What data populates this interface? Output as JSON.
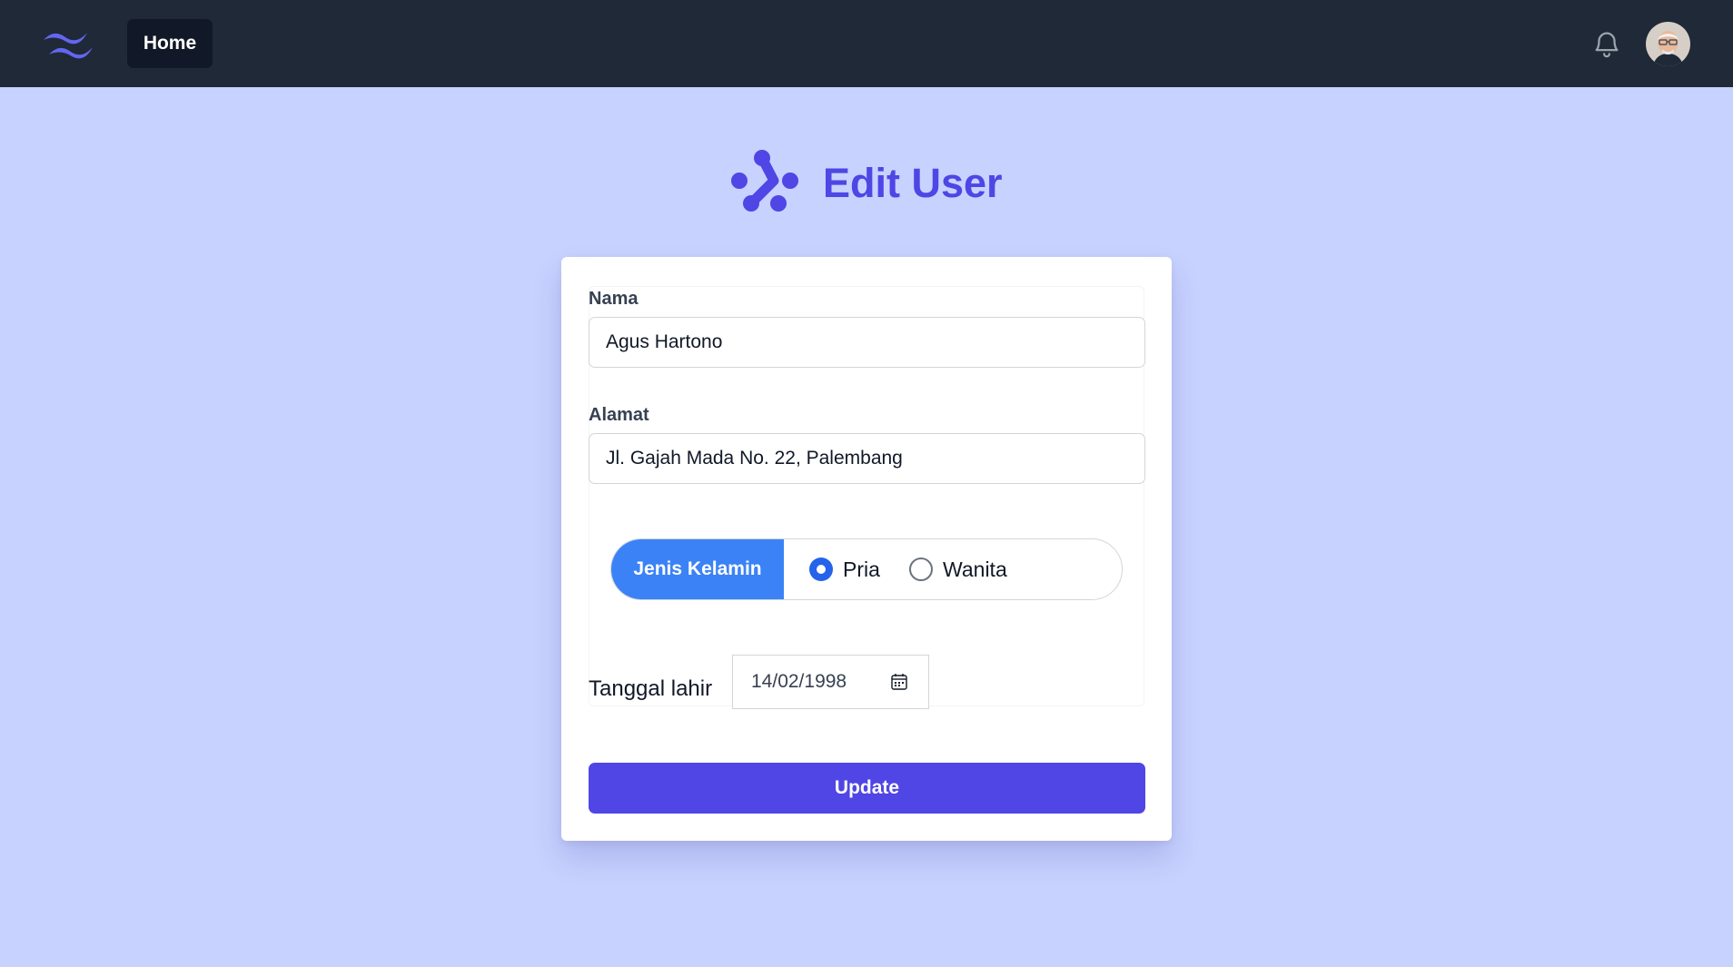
{
  "navbar": {
    "logo_icon": "tailwind-waves-icon",
    "home_label": "Home",
    "bell_icon": "bell-icon",
    "avatar_icon": "user-avatar"
  },
  "header": {
    "logo_icon": "dots-network-icon",
    "title": "Edit User"
  },
  "form": {
    "name": {
      "label": "Nama",
      "value": "Agus Hartono"
    },
    "address": {
      "label": "Alamat",
      "value": "Jl. Gajah Mada No. 22, Palembang"
    },
    "gender": {
      "label": "Jenis Kelamin",
      "options": [
        {
          "label": "Pria",
          "checked": true
        },
        {
          "label": "Wanita",
          "checked": false
        }
      ]
    },
    "birthdate": {
      "label": "Tanggal lahir",
      "value": "14/02/1998",
      "icon": "calendar-icon"
    },
    "submit_label": "Update"
  },
  "colors": {
    "navbar_bg": "#1f2937",
    "page_bg": "#c7d2fe",
    "accent": "#4f46e5",
    "gender_badge": "#3b82f6",
    "radio_checked": "#2563eb"
  }
}
